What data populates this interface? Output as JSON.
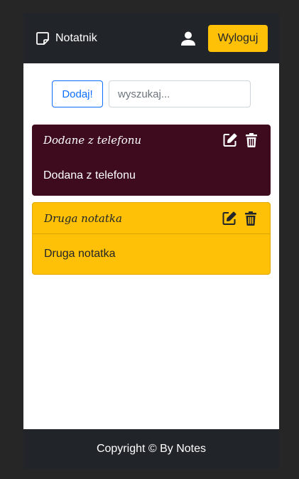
{
  "navbar": {
    "brand_text": "Notatnik",
    "brand_icon": "sticky-note-icon",
    "user_icon": "user-icon",
    "logout_label": "Wyloguj"
  },
  "toolbar": {
    "add_label": "Dodaj!",
    "search_placeholder": "wyszukaj..."
  },
  "notes": [
    {
      "title": "Dodane z telefonu",
      "body": "Dodana z telefonu",
      "color": "#3d0a1e",
      "text_color": "#ffffff"
    },
    {
      "title": "Druga notatka",
      "body": "Druga notatka",
      "color": "#ffc107",
      "text_color": "#212529"
    }
  ],
  "footer": {
    "text": "Copyright © By Notes"
  },
  "colors": {
    "navbar_bg": "#212529",
    "accent": "#ffc107",
    "primary": "#0d6efd",
    "page_bg": "#262626"
  }
}
